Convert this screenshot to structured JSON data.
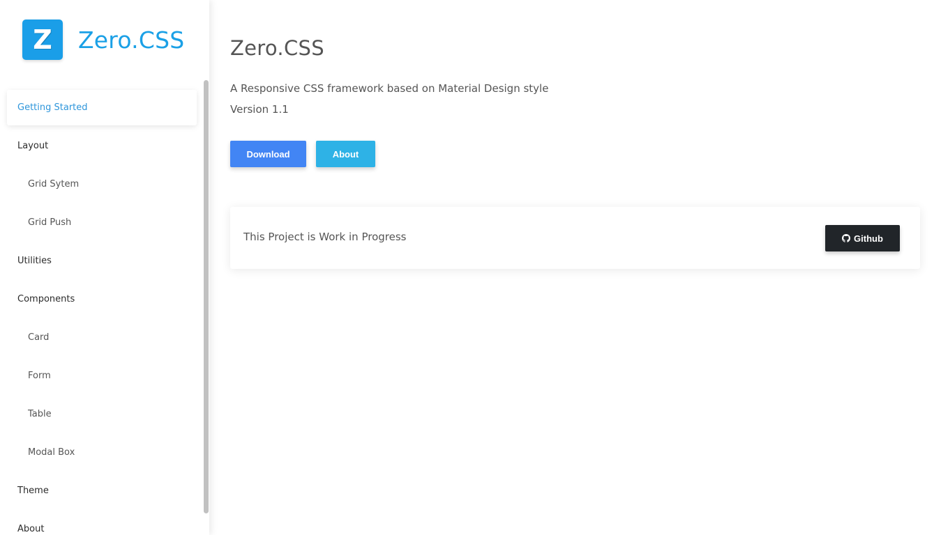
{
  "brand": {
    "logo_letter": "Z",
    "name": "Zero.CSS",
    "logo_color": "#1a9ee8",
    "name_color": "#1aa0e6"
  },
  "sidebar": {
    "items": [
      {
        "label": "Getting Started",
        "level": "top",
        "active": true
      },
      {
        "label": "Layout",
        "level": "top"
      },
      {
        "label": "Grid Sytem",
        "level": "sub"
      },
      {
        "label": "Grid Push",
        "level": "sub"
      },
      {
        "label": "Utilities",
        "level": "top"
      },
      {
        "label": "Components",
        "level": "top"
      },
      {
        "label": "Card",
        "level": "sub"
      },
      {
        "label": "Form",
        "level": "sub"
      },
      {
        "label": "Table",
        "level": "sub"
      },
      {
        "label": "Modal Box",
        "level": "sub"
      },
      {
        "label": "Theme",
        "level": "top"
      },
      {
        "label": "About",
        "level": "top"
      }
    ],
    "active_color": "#2e96db"
  },
  "main": {
    "title": "Zero.CSS",
    "description": "A Responsive CSS framework based on Material Design style",
    "version": "Version 1.1",
    "buttons": {
      "download_label": "Download",
      "about_label": "About",
      "download_color": "#4285f4",
      "about_color": "#2eb2e6"
    },
    "card": {
      "text": "This Project is Work in Progress",
      "github_label": "Github",
      "github_icon": "github-icon",
      "github_color": "#212529"
    }
  }
}
